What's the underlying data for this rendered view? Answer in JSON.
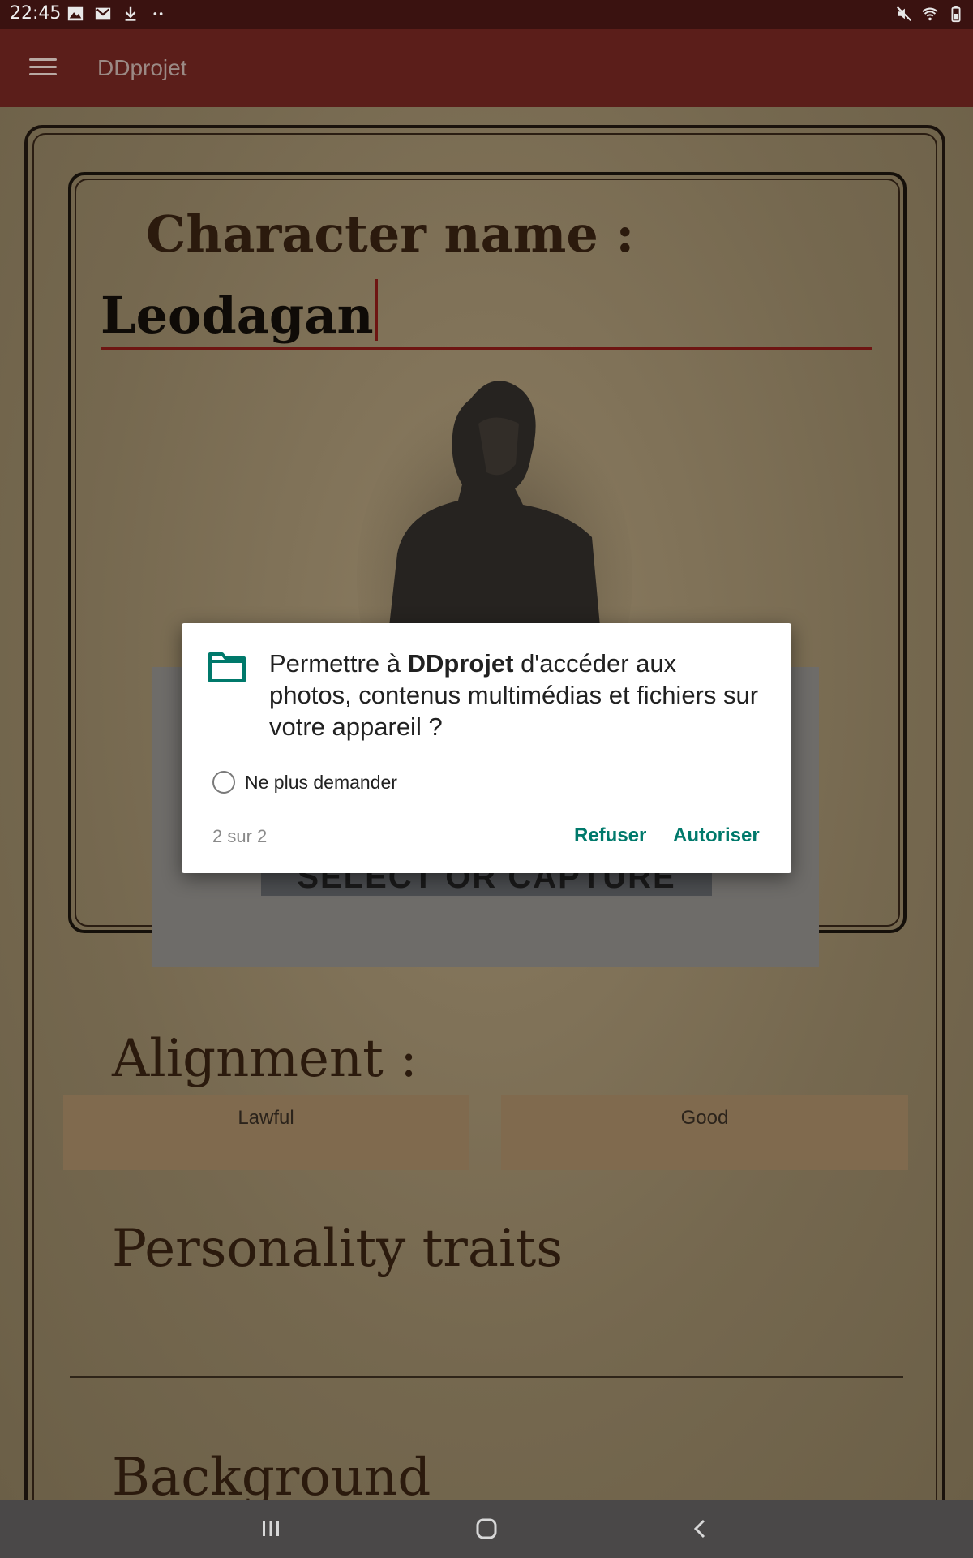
{
  "status_bar": {
    "time": "22:45",
    "left_icons": [
      "image-icon",
      "gmail-icon",
      "download-icon",
      "more-dots-icon"
    ],
    "right_icons": [
      "mute-icon",
      "wifi-icon",
      "battery-icon"
    ]
  },
  "app_bar": {
    "menu_icon": "hamburger-menu-icon",
    "title": "DDprojet"
  },
  "sheet": {
    "character_name_label": "Character name :",
    "character_name_value": "Leodagan",
    "avatar_button_label": "SELECT OR CAPTURE AVATAR",
    "alignment_label": "Alignment :",
    "alignment_options": [
      "Lawful",
      "Good"
    ],
    "personality_label": "Personality traits",
    "background_label": "Background"
  },
  "permission_dialog": {
    "icon": "folder-icon",
    "message_prefix": "Permettre à ",
    "app_name": "DDprojet",
    "message_suffix": " d'accéder aux photos, contenus multimédias et fichiers sur votre appareil ?",
    "dont_ask_label": "Ne plus demander",
    "dont_ask_checked": false,
    "pager": "2 sur 2",
    "deny_label": "Refuser",
    "allow_label": "Autoriser"
  },
  "nav_bar": {
    "buttons": [
      "recents-icon",
      "home-icon",
      "back-icon"
    ]
  },
  "colors": {
    "status_bar": "#3a1210",
    "app_bar": "#5b1e1a",
    "accent": "#00796b",
    "underline": "#6e1512"
  }
}
